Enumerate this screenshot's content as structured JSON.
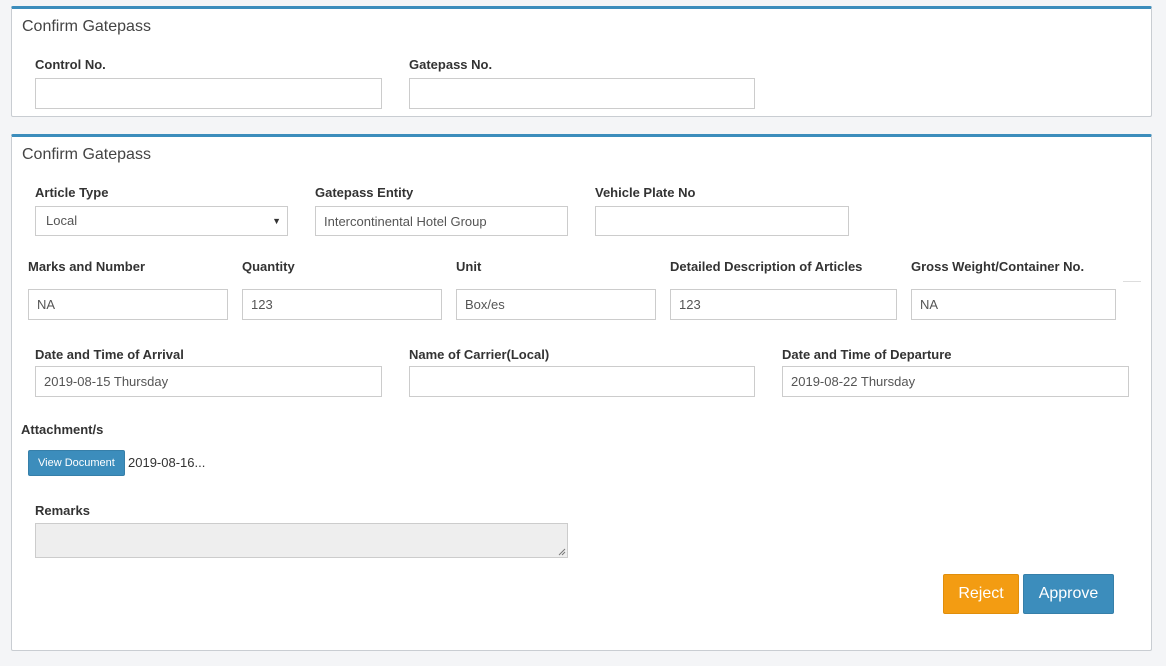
{
  "search_panel": {
    "title": "Confirm Gatepass",
    "control_no_label": "Control No.",
    "control_no_value": "",
    "gatepass_no_label": "Gatepass No.",
    "gatepass_no_value": ""
  },
  "details_panel": {
    "title": "Confirm Gatepass",
    "article_type_label": "Article Type",
    "article_type_value": "Local",
    "gatepass_entity_label": "Gatepass Entity",
    "gatepass_entity_value": "Intercontinental Hotel Group",
    "vehicle_plate_label": "Vehicle Plate No",
    "vehicle_plate_value": "",
    "marks_label": "Marks and Number",
    "marks_value": "NA",
    "quantity_label": "Quantity",
    "quantity_value": "123",
    "unit_label": "Unit",
    "unit_value": "Box/es",
    "description_label": "Detailed Description of Articles",
    "description_value": "123",
    "gross_weight_label": "Gross Weight/Container No.",
    "gross_weight_value": "NA",
    "arrival_label": "Date and Time of Arrival",
    "arrival_value": "2019-08-15 Thursday",
    "carrier_label": "Name of Carrier(Local)",
    "carrier_value": "",
    "departure_label": "Date and Time of Departure",
    "departure_value": "2019-08-22 Thursday",
    "attachments_label": "Attachment/s",
    "view_document_label": "View Document",
    "attachment_filename": "2019-08-16...",
    "remarks_label": "Remarks",
    "remarks_value": "",
    "reject_label": "Reject",
    "approve_label": "Approve"
  },
  "colors": {
    "accent": "#3c8dbc",
    "reject": "#f39c12",
    "page_bg": "#f4f5f7"
  }
}
